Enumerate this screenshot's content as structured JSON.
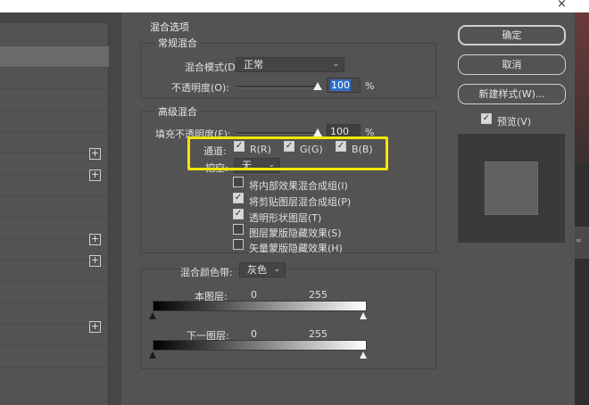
{
  "dialog": {
    "close_glyph": "×"
  },
  "blending_options": {
    "title": "混合选项",
    "general": {
      "title": "常规混合",
      "mode_label": "混合模式(D):",
      "mode_value": "正常",
      "opacity_label": "不透明度(O):",
      "opacity_value": "100",
      "opacity_unit": "%",
      "opacity_level": 1.0
    },
    "advanced": {
      "title": "高级混合",
      "fill_label": "填充不透明度(F):",
      "fill_value": "100",
      "fill_unit": "%",
      "fill_level": 1.0,
      "channels_label": "通道:",
      "channels": [
        {
          "label": "R(R)",
          "checked": true
        },
        {
          "label": "G(G)",
          "checked": true
        },
        {
          "label": "B(B)",
          "checked": true
        }
      ],
      "knockout_label": "挖空:",
      "knockout_value": "无",
      "options": [
        {
          "label": "将内部效果混合成组(I)",
          "checked": false
        },
        {
          "label": "将剪贴图层混合成组(P)",
          "checked": true
        },
        {
          "label": "透明形状图层(T)",
          "checked": true
        },
        {
          "label": "图层蒙版隐藏效果(S)",
          "checked": false
        },
        {
          "label": "矢量蒙版隐藏效果(H)",
          "checked": false
        }
      ]
    },
    "blend_if": {
      "label": "混合颜色带:",
      "value": "灰色",
      "this_layer": {
        "label": "本图层:",
        "low": "0",
        "high": "255"
      },
      "underlying": {
        "label": "下一图层:",
        "low": "0",
        "high": "255"
      }
    }
  },
  "buttons": {
    "ok": "确定",
    "cancel": "取消",
    "new_style": "新建样式(W)...",
    "preview_label": "预览(V)",
    "preview_checked": true
  },
  "icons": {
    "plus": "+",
    "check": "✓",
    "chevron": "⌄"
  },
  "right_edge_tag": "∞"
}
